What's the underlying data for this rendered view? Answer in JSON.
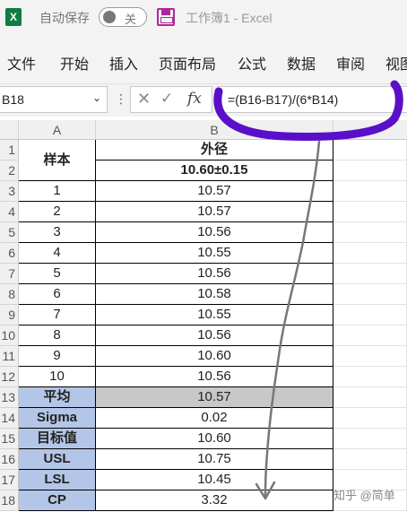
{
  "titlebar": {
    "app_icon": "excel-icon",
    "app_icon_letter": "X",
    "autosave_label": "自动保存",
    "autosave_state": "关",
    "document_title": "工作簿1 - Excel"
  },
  "ribbon": {
    "tabs": [
      "文件",
      "开始",
      "插入",
      "页面布局",
      "公式",
      "数据",
      "审阅",
      "视图"
    ]
  },
  "formula_bar": {
    "name_box": "B18",
    "fx_label": "fx",
    "formula": "=(B16-B17)/(6*B14)"
  },
  "sheet": {
    "columns": [
      "A",
      "B"
    ],
    "row_numbers": [
      "1",
      "2",
      "3",
      "4",
      "5",
      "6",
      "7",
      "8",
      "9",
      "10",
      "11",
      "12",
      "13",
      "14",
      "15",
      "16",
      "17",
      "18"
    ],
    "header": {
      "sample_label": "样本",
      "param_name": "外径",
      "spec": "10.60±0.15"
    },
    "samples": [
      {
        "id": "1",
        "value": "10.57"
      },
      {
        "id": "2",
        "value": "10.57"
      },
      {
        "id": "3",
        "value": "10.56"
      },
      {
        "id": "4",
        "value": "10.55"
      },
      {
        "id": "5",
        "value": "10.56"
      },
      {
        "id": "6",
        "value": "10.58"
      },
      {
        "id": "7",
        "value": "10.55"
      },
      {
        "id": "8",
        "value": "10.56"
      },
      {
        "id": "9",
        "value": "10.60"
      },
      {
        "id": "10",
        "value": "10.56"
      }
    ],
    "stats": [
      {
        "label": "平均",
        "value": "10.57"
      },
      {
        "label": "Sigma",
        "value": "0.02"
      },
      {
        "label": "目标值",
        "value": "10.60"
      },
      {
        "label": "USL",
        "value": "10.75"
      },
      {
        "label": "LSL",
        "value": "10.45"
      },
      {
        "label": "CP",
        "value": "3.32"
      }
    ],
    "selected_cell": "B18"
  },
  "watermark": "知乎 @简单",
  "colors": {
    "excel_green": "#107c41",
    "save_purple": "#b0269a",
    "annotation_purple": "#5a0fc8",
    "stat_label_fill": "#b4c6e7",
    "highlight_fill": "#c8c8c8"
  }
}
